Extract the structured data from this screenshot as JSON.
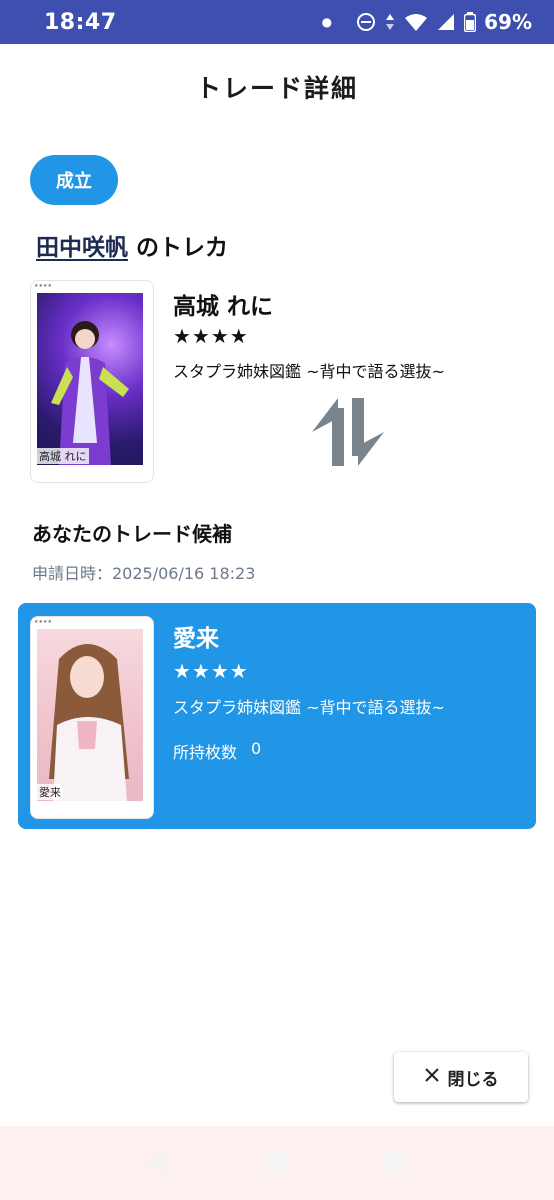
{
  "status_bar": {
    "time": "18:47",
    "battery": "69%",
    "icons": [
      "notification-dot-icon",
      "dnd-icon",
      "data-arrows-icon",
      "wifi-icon",
      "signal-icon",
      "battery-icon"
    ]
  },
  "header": {
    "title": "トレード詳細"
  },
  "trade": {
    "status_label": "成立",
    "owner_name": "田中咲帆",
    "owner_suffix": "のトレカ",
    "offered_card": {
      "member": "高城 れに",
      "stars": "★★★★",
      "series": "スタプラ姉妹図鑑 ~背中で語る選抜~",
      "thumb_name": "高城 れに"
    },
    "candidates_heading": "あなたのトレード候補",
    "request_date_label": "申請日時：2025/06/16 18:23",
    "candidate_card": {
      "member": "愛来",
      "stars": "★★★★",
      "series": "スタプラ姉妹図鑑 ~背中で語る選抜~",
      "owned_label": "所持枚数",
      "owned_count": "0",
      "thumb_name": "愛来"
    }
  },
  "footer": {
    "close_label": "閉じる"
  },
  "colors": {
    "accent": "#2196e6",
    "status_bar": "#3f4fb0",
    "nav_bar": "#fdf0f0"
  }
}
